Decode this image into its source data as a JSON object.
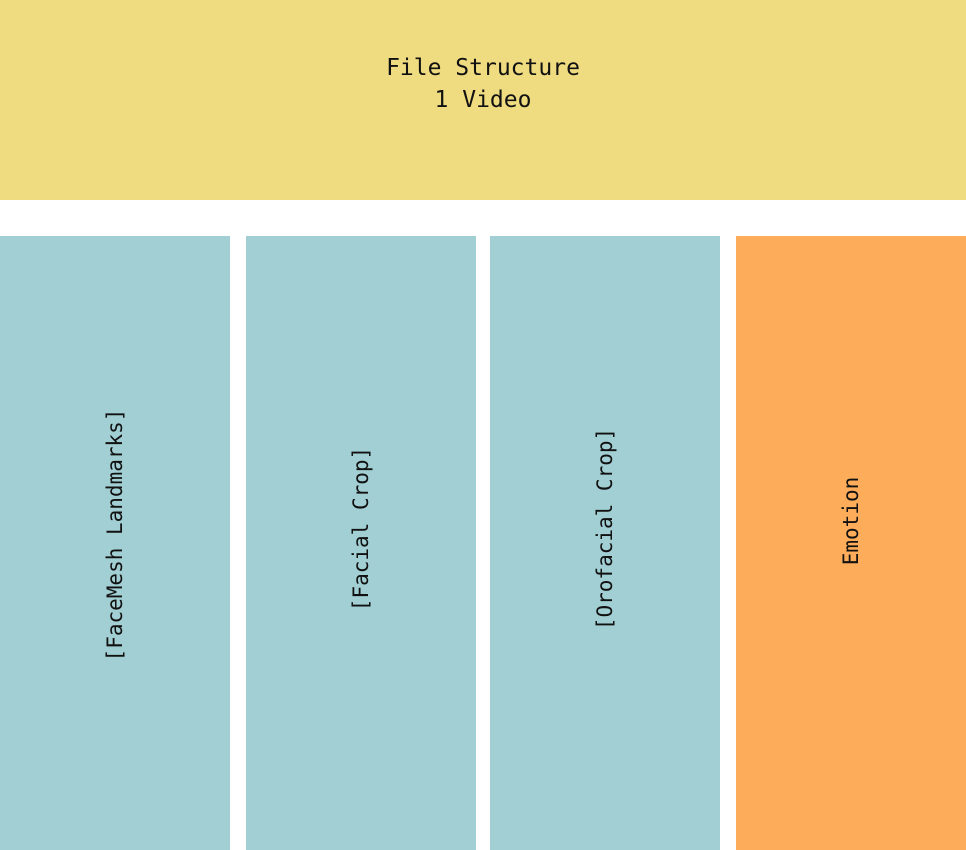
{
  "header": {
    "line1": "File Structure",
    "line2": "1 Video",
    "color": "#F0DC80"
  },
  "columns": [
    {
      "label": "[FaceMesh Landmarks]",
      "color": "#A1CFD3"
    },
    {
      "label": "[Facial Crop]",
      "color": "#A1CFD3"
    },
    {
      "label": "[Orofacial Crop]",
      "color": "#A1CFD3"
    },
    {
      "label": "Emotion",
      "color": "#FDAD5A"
    }
  ]
}
